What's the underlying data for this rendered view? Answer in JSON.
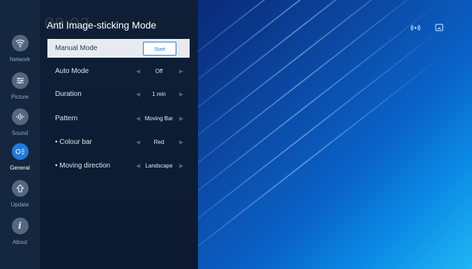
{
  "ghost_clock": "08:02",
  "title": "Anti Image-sticking Mode",
  "nav": [
    {
      "label": "Network",
      "icon": "wifi-icon"
    },
    {
      "label": "Picture",
      "icon": "sliders-icon"
    },
    {
      "label": "Sound",
      "icon": "equalizer-icon"
    },
    {
      "label": "General",
      "icon": "general-settings-icon",
      "active": true
    },
    {
      "label": "Update",
      "icon": "update-arrow-icon"
    },
    {
      "label": "About",
      "icon": "info-icon"
    }
  ],
  "rows": {
    "manual": {
      "label": "Manual Mode",
      "button": "Start"
    },
    "auto": {
      "label": "Auto Mode",
      "value": "Off"
    },
    "duration": {
      "label": "Duration",
      "value": "1 min"
    },
    "pattern": {
      "label": "Pattern",
      "value": "Moving Bar"
    },
    "colour_bar": {
      "label": "• Colour bar",
      "value": "Red"
    },
    "direction": {
      "label": "• Moving direction",
      "value": "Landscape"
    }
  },
  "status_icons": [
    "broadcast-icon",
    "screen-cast-icon"
  ],
  "colors": {
    "accent": "#1e7ae0",
    "panel": "#0e1f37",
    "rail": "#15263f"
  }
}
